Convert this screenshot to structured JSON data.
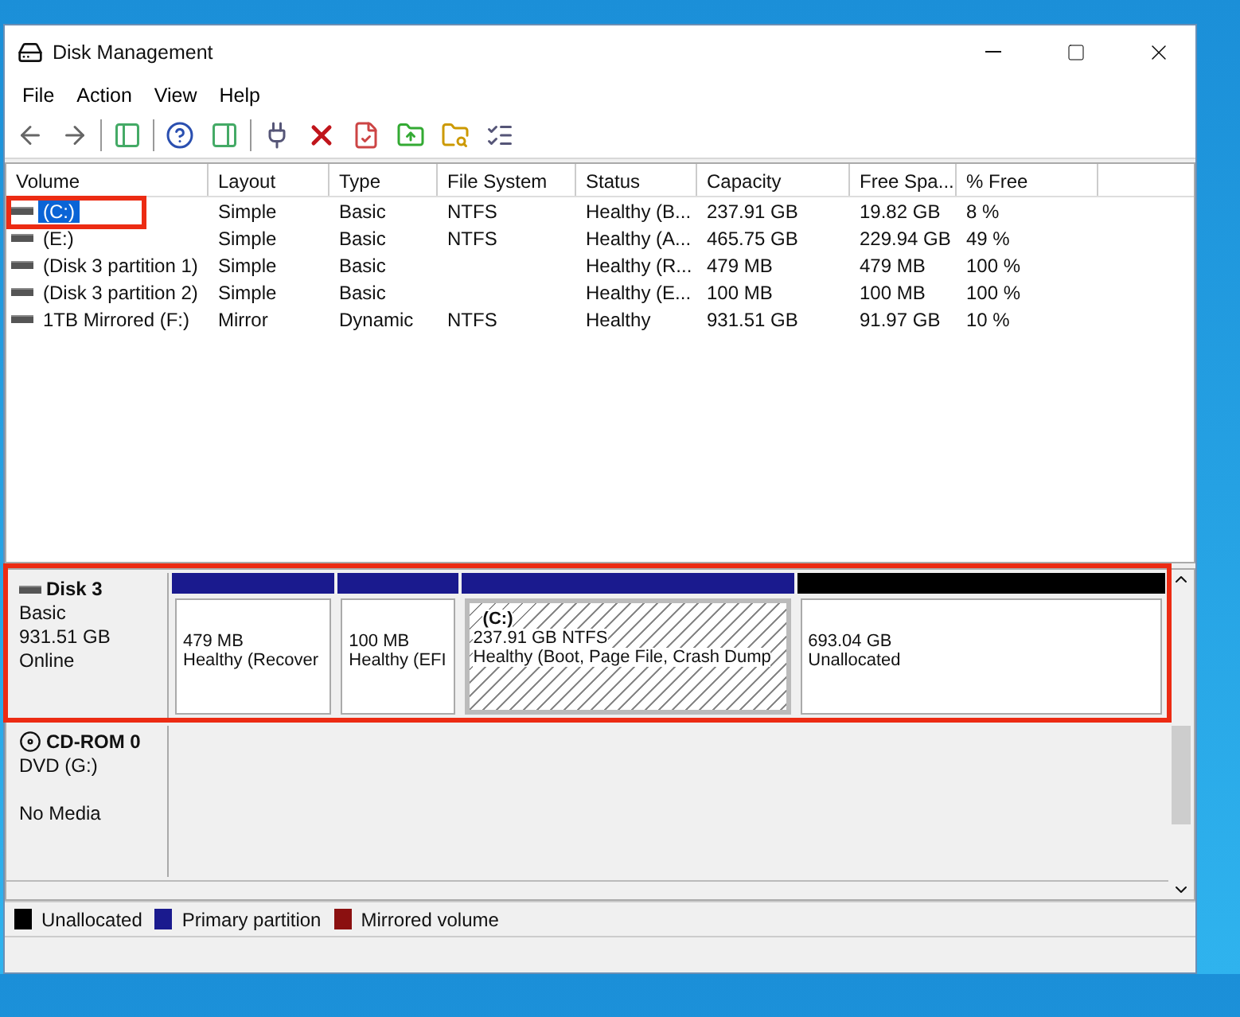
{
  "window": {
    "title": "Disk Management"
  },
  "menu": [
    "File",
    "Action",
    "View",
    "Help"
  ],
  "volumes": {
    "columns": [
      "Volume",
      "Layout",
      "Type",
      "File System",
      "Status",
      "Capacity",
      "Free Spa...",
      "% Free"
    ],
    "rows": [
      {
        "cells": [
          "(C:)",
          "Simple",
          "Basic",
          "NTFS",
          "Healthy (B...",
          "237.91 GB",
          "19.82 GB",
          "8 %"
        ],
        "selected": true,
        "highlight": true
      },
      {
        "cells": [
          "(E:)",
          "Simple",
          "Basic",
          "NTFS",
          "Healthy (A...",
          "465.75 GB",
          "229.94 GB",
          "49 %"
        ],
        "selected": false,
        "highlight": false
      },
      {
        "cells": [
          "(Disk 3 partition 1)",
          "Simple",
          "Basic",
          "",
          "Healthy (R...",
          "479 MB",
          "479 MB",
          "100 %"
        ],
        "selected": false,
        "highlight": false
      },
      {
        "cells": [
          "(Disk 3 partition 2)",
          "Simple",
          "Basic",
          "",
          "Healthy (E...",
          "100 MB",
          "100 MB",
          "100 %"
        ],
        "selected": false,
        "highlight": false
      },
      {
        "cells": [
          "1TB Mirrored (F:)",
          "Mirror",
          "Dynamic",
          "NTFS",
          "Healthy",
          "931.51 GB",
          "91.97 GB",
          "10 %"
        ],
        "selected": false,
        "highlight": false
      }
    ]
  },
  "disks": [
    {
      "kind": "disk",
      "name": "Disk 3",
      "type": "Basic",
      "size": "931.51 GB",
      "status": "Online",
      "highlight": true,
      "partitions": [
        {
          "kind": "primary",
          "size": "479 MB",
          "status": "Healthy (Recover",
          "selected": false
        },
        {
          "kind": "primary",
          "size": "100 MB",
          "status": "Healthy (EFI",
          "selected": false
        },
        {
          "kind": "primary",
          "label": "(C:)",
          "size": "237.91 GB NTFS",
          "status": "Healthy (Boot, Page File, Crash Dump",
          "selected": true
        },
        {
          "kind": "unallocated",
          "size": "693.04 GB",
          "status": "Unallocated",
          "selected": false
        }
      ]
    },
    {
      "kind": "cdrom",
      "name": "CD-ROM 0",
      "type": "DVD (G:)",
      "status": "No Media",
      "highlight": false
    }
  ],
  "legend": [
    {
      "label": "Unallocated",
      "color": "#000000"
    },
    {
      "label": "Primary partition",
      "color": "#1a1a8e"
    },
    {
      "label": "Mirrored volume",
      "color": "#8b1010"
    }
  ]
}
